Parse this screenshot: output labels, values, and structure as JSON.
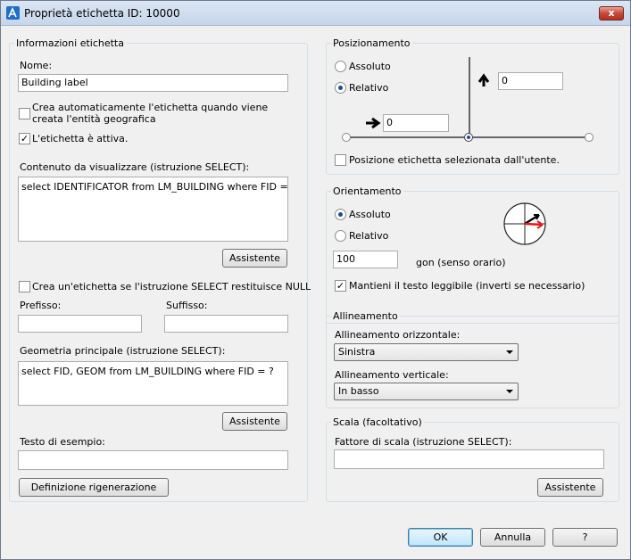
{
  "window": {
    "title": "Proprietà etichetta ID: 10000",
    "close_label": "x"
  },
  "info": {
    "legend": "Informazioni etichetta",
    "name_label": "Nome:",
    "name_value": "Building label",
    "auto_create_label": "Crea automaticamente l'etichetta quando viene creata l'entità geografica",
    "auto_create_checked": false,
    "active_label": "L'etichetta è attiva.",
    "active_checked": true,
    "content_label": "Contenuto da visualizzare (istruzione SELECT):",
    "content_value": "select IDENTIFICATOR from LM_BUILDING where FID = $id",
    "assistant_label": "Assistente",
    "null_label": "Crea un'etichetta se l'istruzione SELECT restituisce NULL",
    "null_checked": false,
    "prefix_label": "Prefisso:",
    "prefix_value": "",
    "suffix_label": "Suffisso:",
    "suffix_value": "",
    "geometry_label": "Geometria principale (istruzione SELECT):",
    "geometry_value": "select FID, GEOM from LM_BUILDING where FID = ?",
    "assistant2_label": "Assistente",
    "sample_label": "Testo di esempio:",
    "sample_value": "",
    "regen_label": "Definizione rigenerazione"
  },
  "position": {
    "legend": "Posizionamento",
    "absolute_label": "Assoluto",
    "relative_label": "Relativo",
    "selected": "relative",
    "y_value": "0",
    "x_value": "0",
    "user_selected_label": "Posizione etichetta selezionata dall'utente.",
    "user_selected_checked": false,
    "slider_position": "center"
  },
  "orientation": {
    "legend": "Orientamento",
    "absolute_label": "Assoluto",
    "relative_label": "Relativo",
    "selected": "absolute",
    "angle_value": "100",
    "angle_unit": "gon (senso orario)",
    "readable_label": "Mantieni il testo leggibile (inverti se necessario)",
    "readable_checked": true
  },
  "alignment": {
    "legend": "Allineamento",
    "horizontal_label": "Allineamento orizzontale:",
    "horizontal_value": "Sinistra",
    "vertical_label": "Allineamento verticale:",
    "vertical_value": "In basso"
  },
  "scale": {
    "legend": "Scala (facoltativo)",
    "factor_label": "Fattore di scala (istruzione SELECT):",
    "factor_value": "",
    "assistant_label": "Assistente"
  },
  "footer": {
    "ok_label": "OK",
    "cancel_label": "Annulla",
    "help_label": "?"
  },
  "colors": {
    "accent": "#1b4d92",
    "close": "#c7493a",
    "compass_red": "#e11b1b"
  }
}
